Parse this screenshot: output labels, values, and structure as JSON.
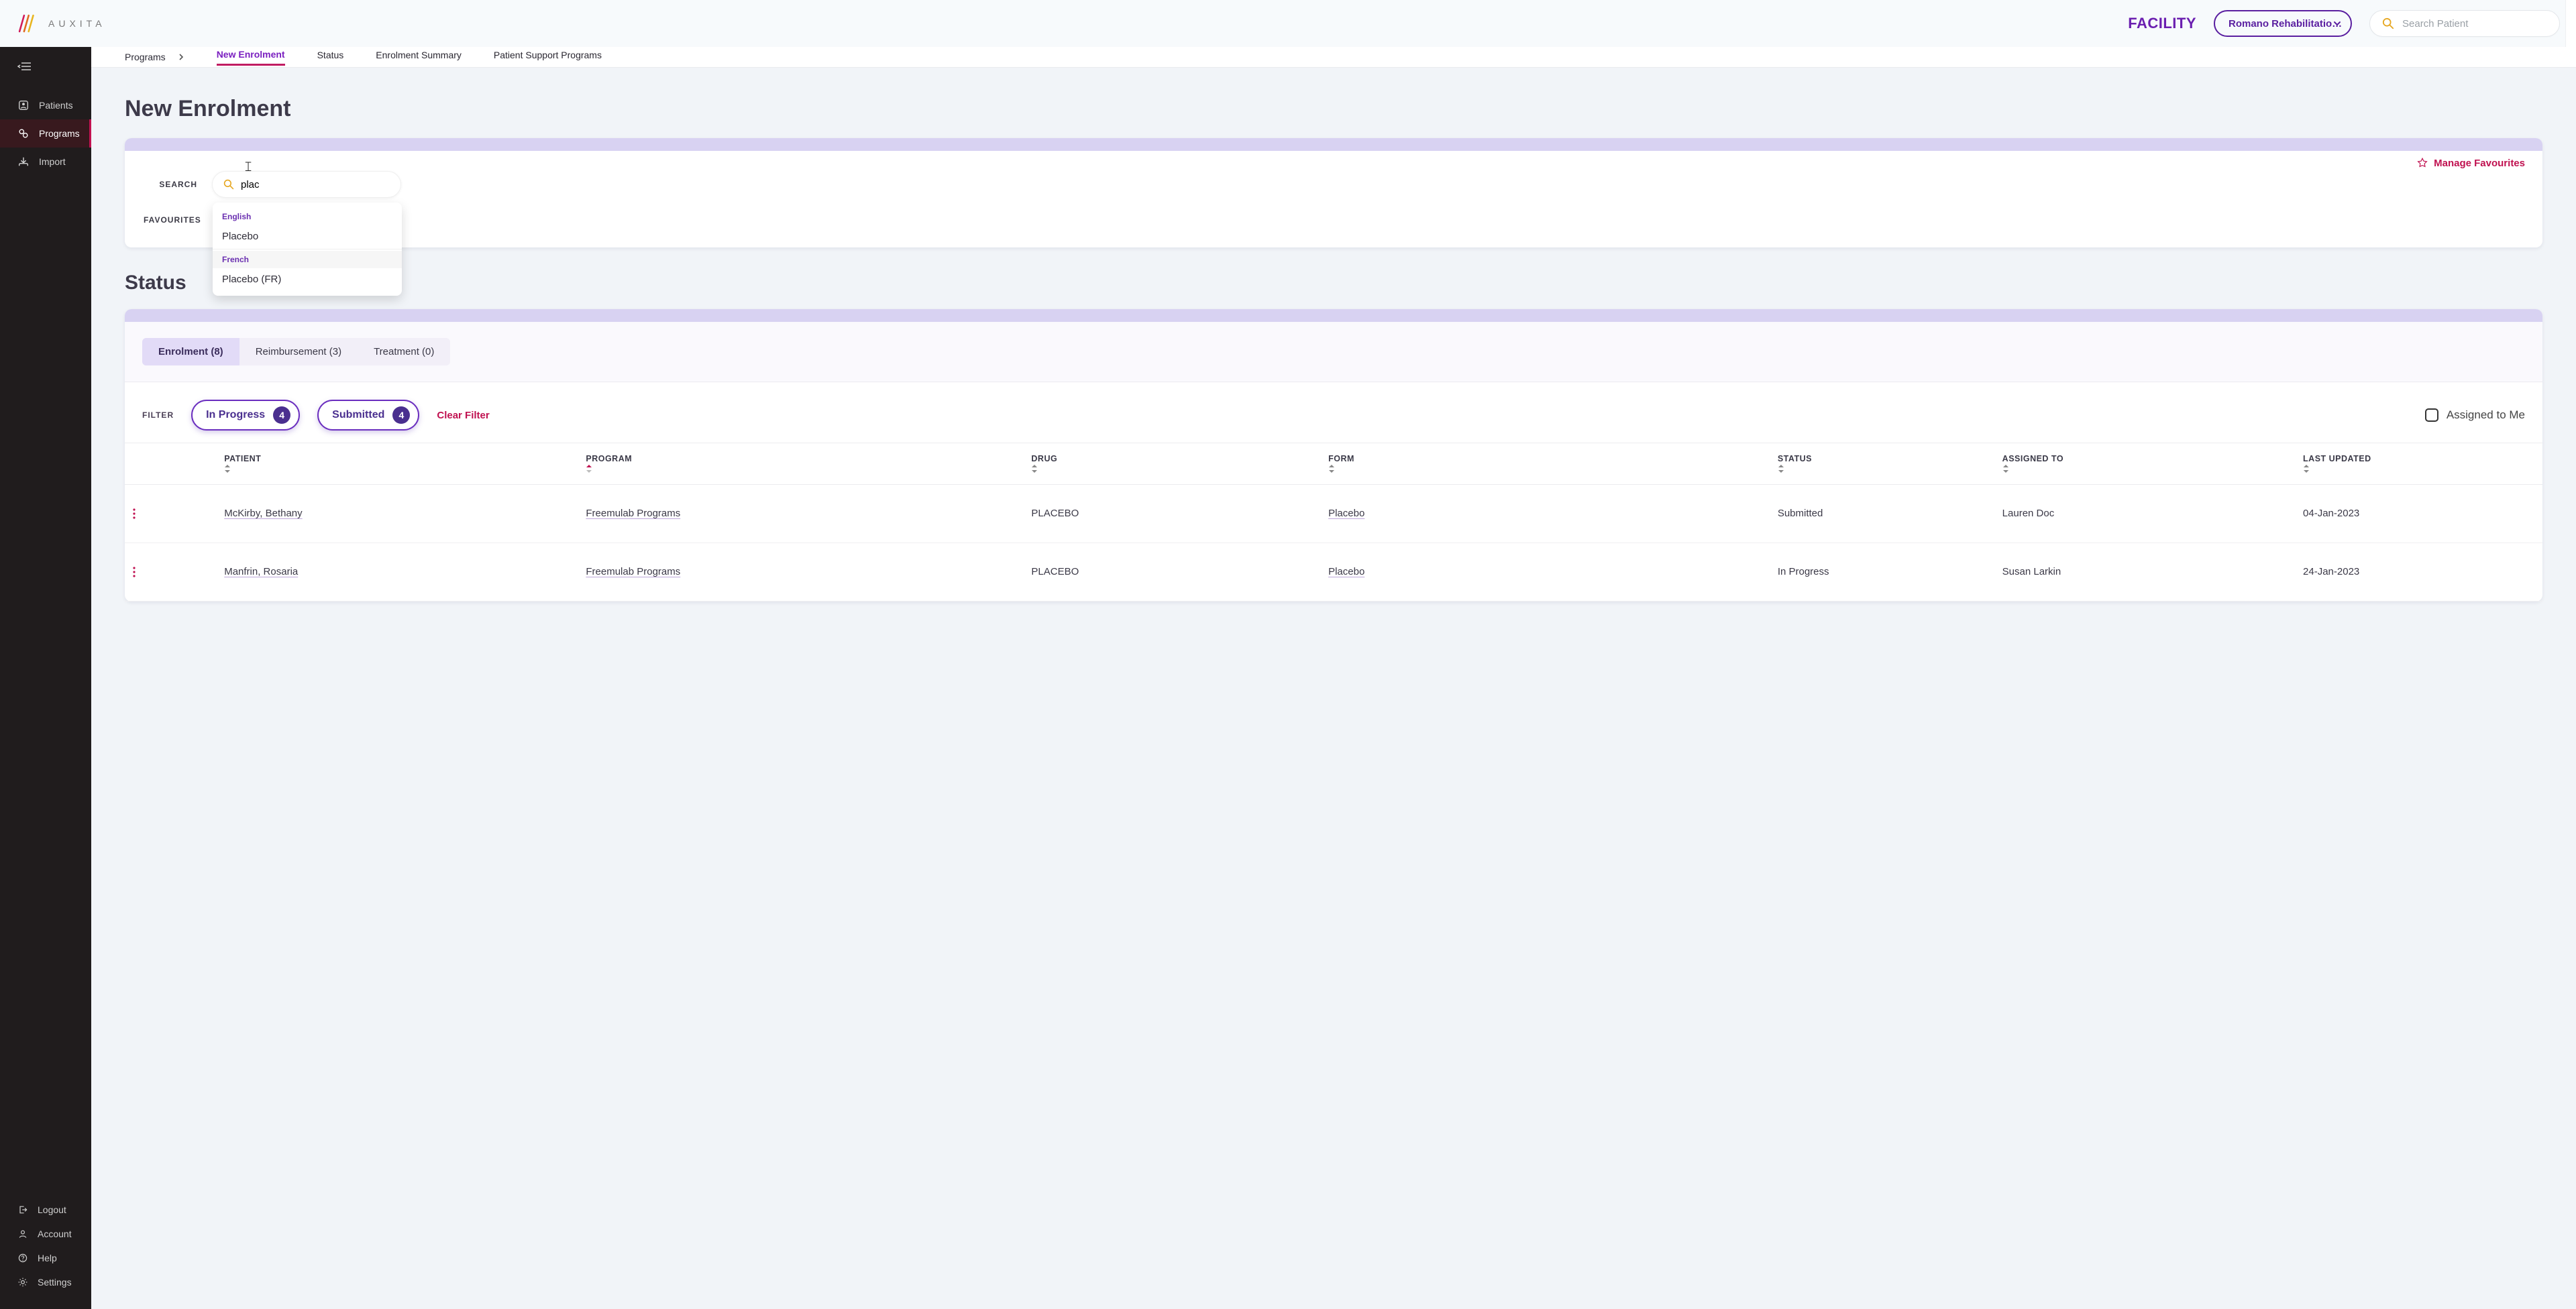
{
  "brand": "AUXITA",
  "header": {
    "facility_label": "FACILITY",
    "facility_value": "Romano Rehabilitatio…",
    "search_placeholder": "Search Patient"
  },
  "sidebar": {
    "items": [
      {
        "label": "Patients",
        "icon": "patient-icon"
      },
      {
        "label": "Programs",
        "icon": "programs-icon"
      },
      {
        "label": "Import",
        "icon": "import-icon"
      }
    ],
    "bottom": [
      {
        "label": "Logout",
        "icon": "logout-icon"
      },
      {
        "label": "Account",
        "icon": "account-icon"
      },
      {
        "label": "Help",
        "icon": "help-icon"
      },
      {
        "label": "Settings",
        "icon": "settings-icon"
      }
    ]
  },
  "breadcrumb": {
    "root": "Programs"
  },
  "subnav": [
    {
      "label": "New Enrolment",
      "active": true
    },
    {
      "label": "Status"
    },
    {
      "label": "Enrolment Summary"
    },
    {
      "label": "Patient Support Programs"
    }
  ],
  "page_title": "New Enrolment",
  "enrol": {
    "manage_fav": "Manage Favourites",
    "search_label": "SEARCH",
    "favourites_label": "FAVOURITES",
    "search_value": "plac",
    "dropdown": {
      "group1": "English",
      "item1": "Placebo",
      "group2": "French",
      "item2": "Placebo (FR)"
    }
  },
  "status_title": "Status",
  "status_tabs": [
    {
      "label": "Enrolment (8)",
      "active": true
    },
    {
      "label": "Reimbursement (3)"
    },
    {
      "label": "Treatment (0)"
    }
  ],
  "filter": {
    "label": "FILTER",
    "chips": [
      {
        "label": "In Progress",
        "count": "4"
      },
      {
        "label": "Submitted",
        "count": "4"
      }
    ],
    "clear": "Clear Filter",
    "assigned": "Assigned to Me"
  },
  "table": {
    "headers": {
      "patient": "PATIENT",
      "program": "PROGRAM",
      "drug": "DRUG",
      "form": "FORM",
      "status": "STATUS",
      "assigned": "ASSIGNED TO",
      "updated": "LAST UPDATED"
    },
    "rows": [
      {
        "patient": "McKirby, Bethany",
        "program": "Freemulab Programs",
        "drug": "PLACEBO",
        "form": "Placebo",
        "status": "Submitted",
        "assigned": "Lauren Doc",
        "updated": "04-Jan-2023"
      },
      {
        "patient": "Manfrin, Rosaria",
        "program": "Freemulab Programs",
        "drug": "PLACEBO",
        "form": "Placebo",
        "status": "In Progress",
        "assigned": "Susan Larkin",
        "updated": "24-Jan-2023"
      }
    ]
  },
  "colors": {
    "brand_purple": "#6b1fb0",
    "accent_pink": "#c01150",
    "card_accent": "#d8d2f2",
    "chip_border": "#6b2fbf"
  }
}
